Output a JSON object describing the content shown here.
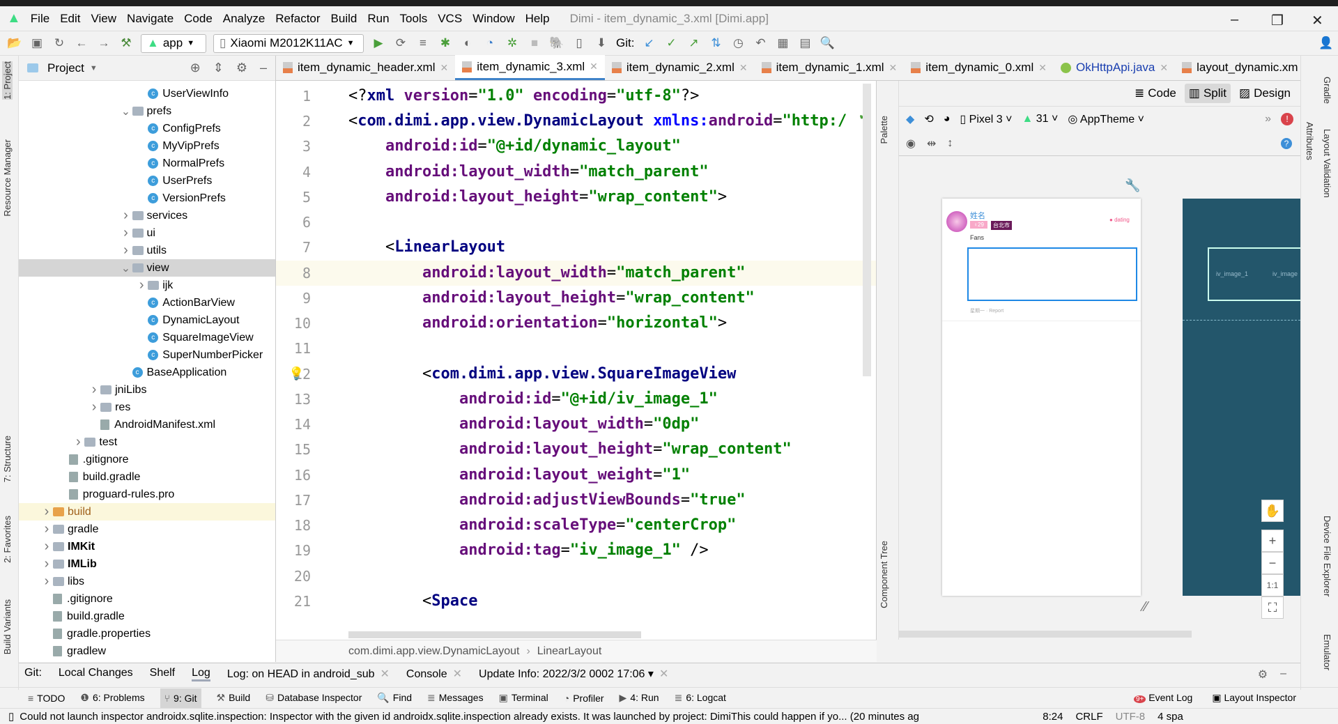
{
  "window": {
    "title": "Dimi - item_dynamic_3.xml [Dimi.app]"
  },
  "menu": [
    "File",
    "Edit",
    "View",
    "Navigate",
    "Code",
    "Analyze",
    "Refactor",
    "Build",
    "Run",
    "Tools",
    "VCS",
    "Window",
    "Help"
  ],
  "toolbar": {
    "run_config": "app",
    "device": "Xiaomi M2012K11AC",
    "git_label": "Git:"
  },
  "project": {
    "title": "Project",
    "items": [
      {
        "label": "UserViewInfo",
        "lvl": 6,
        "type": "class"
      },
      {
        "label": "prefs",
        "lvl": 5,
        "type": "folder",
        "open": true
      },
      {
        "label": "ConfigPrefs",
        "lvl": 6,
        "type": "class"
      },
      {
        "label": "MyVipPrefs",
        "lvl": 6,
        "type": "class"
      },
      {
        "label": "NormalPrefs",
        "lvl": 6,
        "type": "class"
      },
      {
        "label": "UserPrefs",
        "lvl": 6,
        "type": "class"
      },
      {
        "label": "VersionPrefs",
        "lvl": 6,
        "type": "class"
      },
      {
        "label": "services",
        "lvl": 5,
        "type": "folder"
      },
      {
        "label": "ui",
        "lvl": 5,
        "type": "folder"
      },
      {
        "label": "utils",
        "lvl": 5,
        "type": "folder"
      },
      {
        "label": "view",
        "lvl": 5,
        "type": "folder",
        "open": true,
        "selected": true
      },
      {
        "label": "ijk",
        "lvl": 6,
        "type": "folder"
      },
      {
        "label": "ActionBarView",
        "lvl": 6,
        "type": "class"
      },
      {
        "label": "DynamicLayout",
        "lvl": 6,
        "type": "class"
      },
      {
        "label": "SquareImageView",
        "lvl": 6,
        "type": "class"
      },
      {
        "label": "SuperNumberPicker",
        "lvl": 6,
        "type": "class"
      },
      {
        "label": "BaseApplication",
        "lvl": 5,
        "type": "class"
      },
      {
        "label": "jniLibs",
        "lvl": 3,
        "type": "folder"
      },
      {
        "label": "res",
        "lvl": 3,
        "type": "folder"
      },
      {
        "label": "AndroidManifest.xml",
        "lvl": 3,
        "type": "file"
      },
      {
        "label": "test",
        "lvl": 2,
        "type": "folder"
      },
      {
        "label": ".gitignore",
        "lvl": 1,
        "type": "file"
      },
      {
        "label": "build.gradle",
        "lvl": 1,
        "type": "file"
      },
      {
        "label": "proguard-rules.pro",
        "lvl": 1,
        "type": "file"
      },
      {
        "label": "build",
        "lvl": 0,
        "type": "folder",
        "orange": true,
        "highlight": true
      },
      {
        "label": "gradle",
        "lvl": 0,
        "type": "folder"
      },
      {
        "label": "IMKit",
        "lvl": 0,
        "type": "folder",
        "bold": true
      },
      {
        "label": "IMLib",
        "lvl": 0,
        "type": "folder",
        "bold": true
      },
      {
        "label": "libs",
        "lvl": 0,
        "type": "folder"
      },
      {
        "label": ".gitignore",
        "lvl": 0,
        "type": "file"
      },
      {
        "label": "build.gradle",
        "lvl": 0,
        "type": "file"
      },
      {
        "label": "gradle.properties",
        "lvl": 0,
        "type": "file"
      },
      {
        "label": "gradlew",
        "lvl": 0,
        "type": "file"
      }
    ]
  },
  "tabs": [
    {
      "label": "item_dynamic_header.xml"
    },
    {
      "label": "item_dynamic_3.xml",
      "active": true
    },
    {
      "label": "item_dynamic_2.xml"
    },
    {
      "label": "item_dynamic_1.xml"
    },
    {
      "label": "item_dynamic_0.xml"
    },
    {
      "label": "OkHttpApi.java",
      "java": true
    },
    {
      "label": "layout_dynamic.xm"
    }
  ],
  "code": [
    [
      [
        "t-pl",
        "<?"
      ],
      [
        "t-tag",
        "xml "
      ],
      [
        "t-attr",
        "version"
      ],
      [
        "t-pl",
        "="
      ],
      [
        "t-val",
        "\"1.0\" "
      ],
      [
        "t-attr",
        "encoding"
      ],
      [
        "t-pl",
        "="
      ],
      [
        "t-val",
        "\"utf-8\""
      ],
      [
        "t-pl",
        "?>"
      ]
    ],
    [
      [
        "t-pl",
        "<"
      ],
      [
        "t-tag",
        "com.dimi.app.view.DynamicLayout "
      ],
      [
        "t-ns",
        "xmlns:"
      ],
      [
        "t-attr",
        "android"
      ],
      [
        "t-pl",
        "="
      ],
      [
        "t-val",
        "\"http:/"
      ]
    ],
    [
      [
        "t-pl",
        "    "
      ],
      [
        "t-attr",
        "android:id"
      ],
      [
        "t-pl",
        "="
      ],
      [
        "t-val",
        "\"@+id/dynamic_layout\""
      ]
    ],
    [
      [
        "t-pl",
        "    "
      ],
      [
        "t-attr",
        "android:layout_width"
      ],
      [
        "t-pl",
        "="
      ],
      [
        "t-val",
        "\"match_parent\""
      ]
    ],
    [
      [
        "t-pl",
        "    "
      ],
      [
        "t-attr",
        "android:layout_height"
      ],
      [
        "t-pl",
        "="
      ],
      [
        "t-val",
        "\"wrap_content\""
      ],
      [
        "t-pl",
        ">"
      ]
    ],
    [],
    [
      [
        "t-pl",
        "    <"
      ],
      [
        "t-tag",
        "LinearLayout"
      ]
    ],
    [
      [
        "t-pl",
        "        "
      ],
      [
        "t-attr",
        "android:layout_width"
      ],
      [
        "t-pl",
        "="
      ],
      [
        "t-val",
        "\"match_parent\""
      ]
    ],
    [
      [
        "t-pl",
        "        "
      ],
      [
        "t-attr",
        "android:layout_height"
      ],
      [
        "t-pl",
        "="
      ],
      [
        "t-val",
        "\"wrap_content\""
      ]
    ],
    [
      [
        "t-pl",
        "        "
      ],
      [
        "t-attr",
        "android:orientation"
      ],
      [
        "t-pl",
        "="
      ],
      [
        "t-val",
        "\"horizontal\""
      ],
      [
        "t-pl",
        ">"
      ]
    ],
    [],
    [
      [
        "t-pl",
        "        <"
      ],
      [
        "t-tag",
        "com.dimi.app.view.SquareImageView"
      ]
    ],
    [
      [
        "t-pl",
        "            "
      ],
      [
        "t-attr",
        "android:id"
      ],
      [
        "t-pl",
        "="
      ],
      [
        "t-val",
        "\"@+id/iv_image_1\""
      ]
    ],
    [
      [
        "t-pl",
        "            "
      ],
      [
        "t-attr",
        "android:layout_width"
      ],
      [
        "t-pl",
        "="
      ],
      [
        "t-val",
        "\"0dp\""
      ]
    ],
    [
      [
        "t-pl",
        "            "
      ],
      [
        "t-attr",
        "android:layout_height"
      ],
      [
        "t-pl",
        "="
      ],
      [
        "t-val",
        "\"wrap_content\""
      ]
    ],
    [
      [
        "t-pl",
        "            "
      ],
      [
        "t-attr",
        "android:layout_weight"
      ],
      [
        "t-pl",
        "="
      ],
      [
        "t-val",
        "\"1\""
      ]
    ],
    [
      [
        "t-pl",
        "            "
      ],
      [
        "t-attr",
        "android:adjustViewBounds"
      ],
      [
        "t-pl",
        "="
      ],
      [
        "t-val",
        "\"true\""
      ]
    ],
    [
      [
        "t-pl",
        "            "
      ],
      [
        "t-attr",
        "android:scaleType"
      ],
      [
        "t-pl",
        "="
      ],
      [
        "t-val",
        "\"centerCrop\""
      ]
    ],
    [
      [
        "t-pl",
        "            "
      ],
      [
        "t-attr",
        "android:tag"
      ],
      [
        "t-pl",
        "="
      ],
      [
        "t-val",
        "\"iv_image_1\""
      ],
      [
        "t-pl",
        " />"
      ]
    ],
    [],
    [
      [
        "t-pl",
        "        <"
      ],
      [
        "t-tag",
        "Space"
      ]
    ]
  ],
  "current_line": 8,
  "breadcrumb": [
    "com.dimi.app.view.DynamicLayout",
    "LinearLayout"
  ],
  "design": {
    "modes": [
      "Code",
      "Split",
      "Design"
    ],
    "active_mode": "Split",
    "device": "Pixel 3",
    "api": "31",
    "theme": "AppTheme",
    "preview": {
      "name": "姓名",
      "age": "♀29",
      "city": "台北市",
      "badge": "dating",
      "fans": "Fans",
      "footer": "星期一 · Report"
    },
    "blueprint_labels": [
      "iv_image_1",
      "iv_image"
    ],
    "zoom_fit": "1:1"
  },
  "side_tabs": {
    "left": [
      "1: Project",
      "Resource Manager",
      "7: Structure",
      "2: Favorites",
      "Build Variants"
    ],
    "right": [
      "Gradle",
      "Layout Validation",
      "Device File Explorer",
      "Emulator"
    ],
    "palette": "Palette",
    "component_tree": "Component Tree",
    "attributes": "Attributes"
  },
  "git_tabs": [
    {
      "label": "Git:"
    },
    {
      "label": "Local Changes"
    },
    {
      "label": "Shelf"
    },
    {
      "label": "Log",
      "active": true
    },
    {
      "label": "Log: on HEAD in android_sub",
      "close": true
    },
    {
      "label": "Console",
      "close": true
    },
    {
      "label": "Update Info: 2022/3/2 0002 17:06 ▾",
      "close": true
    }
  ],
  "tool_windows": [
    {
      "label": "TODO"
    },
    {
      "label": "6: Problems"
    },
    {
      "label": "9: Git",
      "active": true
    },
    {
      "label": "Build"
    },
    {
      "label": "Database Inspector"
    },
    {
      "label": "Find"
    },
    {
      "label": "Messages"
    },
    {
      "label": "Terminal"
    },
    {
      "label": "Profiler"
    },
    {
      "label": "4: Run"
    },
    {
      "label": "6: Logcat"
    }
  ],
  "tool_windows_right": [
    "Event Log",
    "Layout Inspector"
  ],
  "status": {
    "message": "Could not launch inspector androidx.sqlite.inspection: Inspector with the given id androidx.sqlite.inspection already exists. It was launched by project: DimiThis could happen if yo... (20 minutes ag",
    "position": "8:24",
    "line_sep": "CRLF",
    "encoding": "UTF-8",
    "indent": "4 spa"
  },
  "colors": {
    "accent": "#4083c9",
    "blueprint": "#23566b",
    "selection": "#1e88e5"
  }
}
